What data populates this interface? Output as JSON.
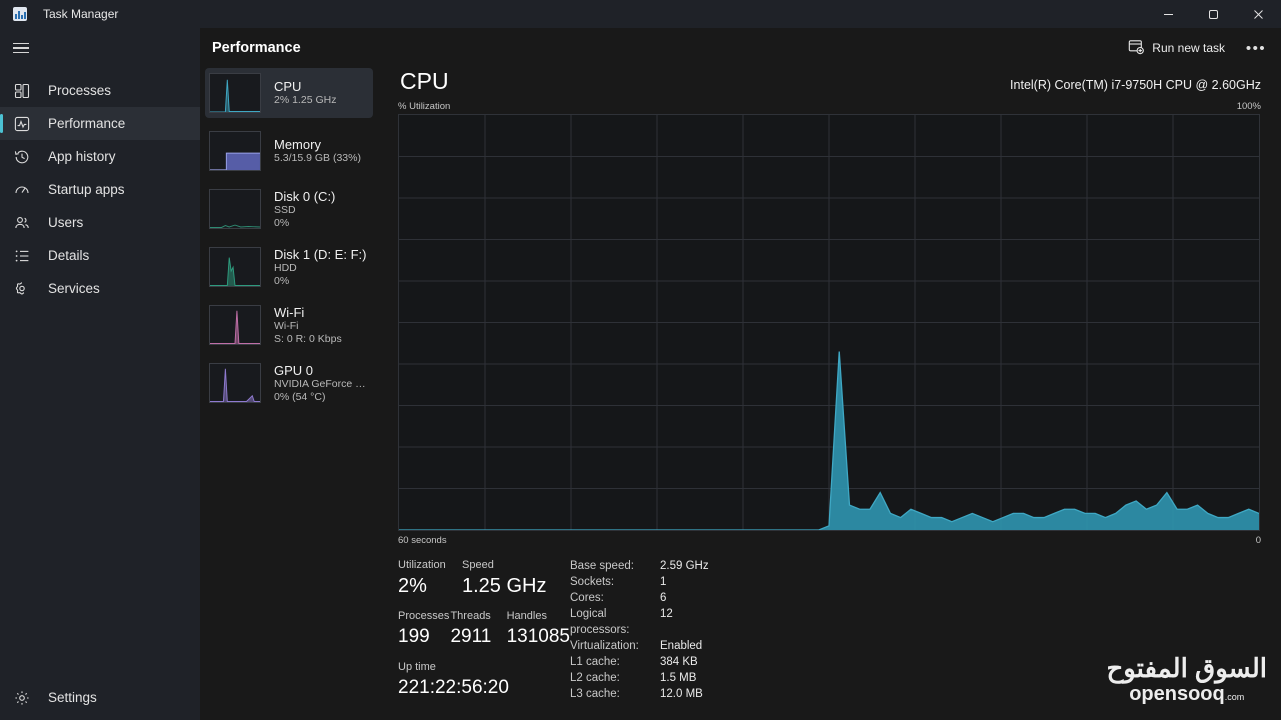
{
  "window": {
    "title": "Task Manager",
    "app_icon": "task-manager-icon",
    "minimize": "–",
    "maximize": "❐",
    "close": "✕"
  },
  "sidebar": {
    "menu_icon": "hamburger-icon",
    "items": [
      {
        "label": "Processes",
        "icon": "processes-icon",
        "active": false
      },
      {
        "label": "Performance",
        "icon": "performance-icon",
        "active": true
      },
      {
        "label": "App history",
        "icon": "history-icon",
        "active": false
      },
      {
        "label": "Startup apps",
        "icon": "startup-icon",
        "active": false
      },
      {
        "label": "Users",
        "icon": "users-icon",
        "active": false
      },
      {
        "label": "Details",
        "icon": "details-icon",
        "active": false
      },
      {
        "label": "Services",
        "icon": "services-icon",
        "active": false
      }
    ],
    "settings": {
      "label": "Settings",
      "icon": "gear-icon"
    }
  },
  "header": {
    "title": "Performance",
    "run_new_task": "Run new task",
    "run_new_task_icon": "run-new-task-icon",
    "more_options": "•••"
  },
  "resources": [
    {
      "name": "CPU",
      "line1": "2%  1.25 GHz",
      "line2": "",
      "active": true,
      "color": "#3fa8c4",
      "chart": "cpu"
    },
    {
      "name": "Memory",
      "line1": "5.3/15.9 GB (33%)",
      "line2": "",
      "active": false,
      "color": "#6b74d6",
      "chart": "memory"
    },
    {
      "name": "Disk 0 (C:)",
      "line1": "SSD",
      "line2": "0%",
      "active": false,
      "color": "#2e8b72",
      "chart": "disk0"
    },
    {
      "name": "Disk 1 (D: E: F:)",
      "line1": "HDD",
      "line2": "0%",
      "active": false,
      "color": "#2e9b7e",
      "chart": "disk1"
    },
    {
      "name": "Wi-Fi",
      "line1": "Wi-Fi",
      "line2": "S: 0 R: 0 Kbps",
      "active": false,
      "color": "#c06fa8",
      "chart": "wifi"
    },
    {
      "name": "GPU 0",
      "line1": "NVIDIA GeForce RTX...",
      "line2": "0%  (54 °C)",
      "active": false,
      "color": "#8f7ad0",
      "chart": "gpu"
    }
  ],
  "detail": {
    "title": "CPU",
    "model": "Intel(R) Core(TM) i7-9750H CPU @ 2.60GHz",
    "y_label": "% Utilization",
    "y_max_label": "100%",
    "x_left_label": "60 seconds",
    "x_right_label": "0",
    "accent_color": "#3fa8c4"
  },
  "stats": {
    "primary": [
      {
        "label": "Utilization",
        "value": "2%"
      },
      {
        "label": "Speed",
        "value": "1.25 GHz"
      }
    ],
    "secondary": [
      {
        "label": "Processes",
        "value": "199"
      },
      {
        "label": "Threads",
        "value": "2911"
      },
      {
        "label": "Handles",
        "value": "131085"
      }
    ],
    "uptime": {
      "label": "Up time",
      "value": "221:22:56:20"
    },
    "details": [
      {
        "key": "Base speed:",
        "value": "2.59 GHz"
      },
      {
        "key": "Sockets:",
        "value": "1"
      },
      {
        "key": "Cores:",
        "value": "6"
      },
      {
        "key": "Logical processors:",
        "value": "12"
      },
      {
        "key": "Virtualization:",
        "value": "Enabled"
      },
      {
        "key": "L1 cache:",
        "value": "384 KB"
      },
      {
        "key": "L2 cache:",
        "value": "1.5 MB"
      },
      {
        "key": "L3 cache:",
        "value": "12.0 MB"
      }
    ]
  },
  "watermark": {
    "arabic": "السوق المفتوح",
    "latin": "opensooq",
    "suffix": ".com"
  },
  "chart_data": {
    "type": "area",
    "title": "CPU",
    "subtitle": "Intel(R) Core(TM) i7-9750H CPU @ 2.60GHz",
    "ylabel": "% Utilization",
    "xlabel": "60 seconds",
    "ylim": [
      0,
      100
    ],
    "xlim": [
      60,
      0
    ],
    "x_tick_labels": [
      "60 seconds",
      "0"
    ],
    "y_tick_labels": [
      "100%",
      "0"
    ],
    "grid": true,
    "grid_cols": 10,
    "grid_rows": 10,
    "legend": "none",
    "series": [
      {
        "name": "CPU utilization",
        "color": "#3fa8c4",
        "fill_color": "#2f93ad",
        "values": [
          0,
          0,
          0,
          0,
          0,
          0,
          0,
          0,
          0,
          0,
          0,
          0,
          0,
          0,
          0,
          0,
          0,
          0,
          0,
          0,
          0,
          0,
          0,
          0,
          0,
          0,
          0,
          0,
          0,
          0,
          0,
          0,
          0,
          0,
          0,
          0,
          0,
          0,
          0,
          0,
          0,
          0,
          1,
          43,
          6,
          5,
          5,
          9,
          4,
          3,
          5,
          4,
          3,
          3,
          2,
          3,
          4,
          3,
          2,
          3,
          4,
          4,
          3,
          3,
          4,
          5,
          5,
          4,
          4,
          3,
          4,
          6,
          7,
          5,
          6,
          9,
          5,
          5,
          6,
          4,
          3,
          3,
          4,
          5,
          4
        ]
      }
    ]
  }
}
